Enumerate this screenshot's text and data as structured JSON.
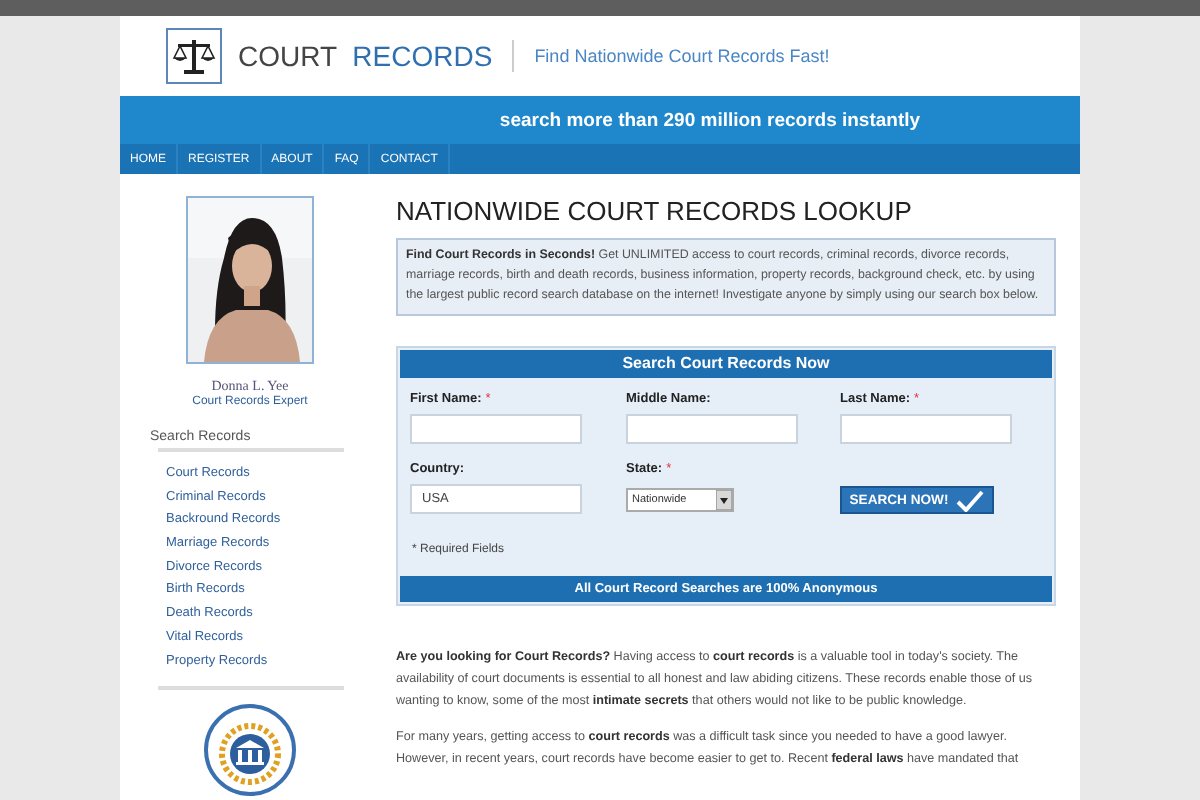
{
  "header": {
    "logo_words": [
      "COURT",
      "RECORDS"
    ],
    "tagline": "Find Nationwide Court Records Fast!"
  },
  "banner": "search more than 290 million records instantly",
  "nav": [
    "HOME",
    "REGISTER",
    "ABOUT",
    "FAQ",
    "CONTACT"
  ],
  "sidebar": {
    "profile": {
      "name": "Donna L. Yee",
      "role": "Court Records Expert"
    },
    "section_title": "Search Records",
    "links": [
      "Court Records",
      "Criminal Records",
      "Backround Records",
      "Marriage Records",
      "Divorce Records",
      "Birth Records",
      "Death Records",
      "Vital Records",
      "Property Records"
    ]
  },
  "main": {
    "title": "NATIONWIDE COURT RECORDS LOOKUP",
    "intro": "**Find Court Records in Seconds!** Get UNLIMITED access to court records, criminal records, divorce records, marriage records, birth and death records, business information, property records, background check, etc. by using the largest public record search database on the internet! Investigate anyone by simply using our search box below.",
    "search_form": {
      "title": "Search Court Records Now",
      "fields": [
        {
          "kind": "text",
          "label": "First Name:",
          "required_mark": "*"
        },
        {
          "kind": "text",
          "label": "Middle Name:"
        },
        {
          "kind": "text",
          "label": "Last Name:",
          "required_mark": "*"
        },
        {
          "kind": "text",
          "label": "Country:",
          "value": "USA"
        },
        {
          "kind": "select",
          "label": "State:",
          "required_mark": "*",
          "value": "Nationwide"
        },
        {
          "kind": "button",
          "label": "SEARCH NOW!"
        }
      ],
      "required_note": "* Required Fields",
      "footer": "All Court Record Searches are 100% Anonymous"
    },
    "paragraphs": [
      "**Are you looking for Court Records?** Having access to **court records** is a valuable tool in today's society. The availability of court documents is essential to all honest and law abiding citizens. These records enable those of us wanting to know, some of the most **intimate secrets** that others would not like to be public knowledge.",
      "For many years, getting access to **court records** was a difficult task since you needed to have a good lawyer. However, in recent years, court records have become easier to get to. Recent **federal laws** have mandated that"
    ]
  }
}
